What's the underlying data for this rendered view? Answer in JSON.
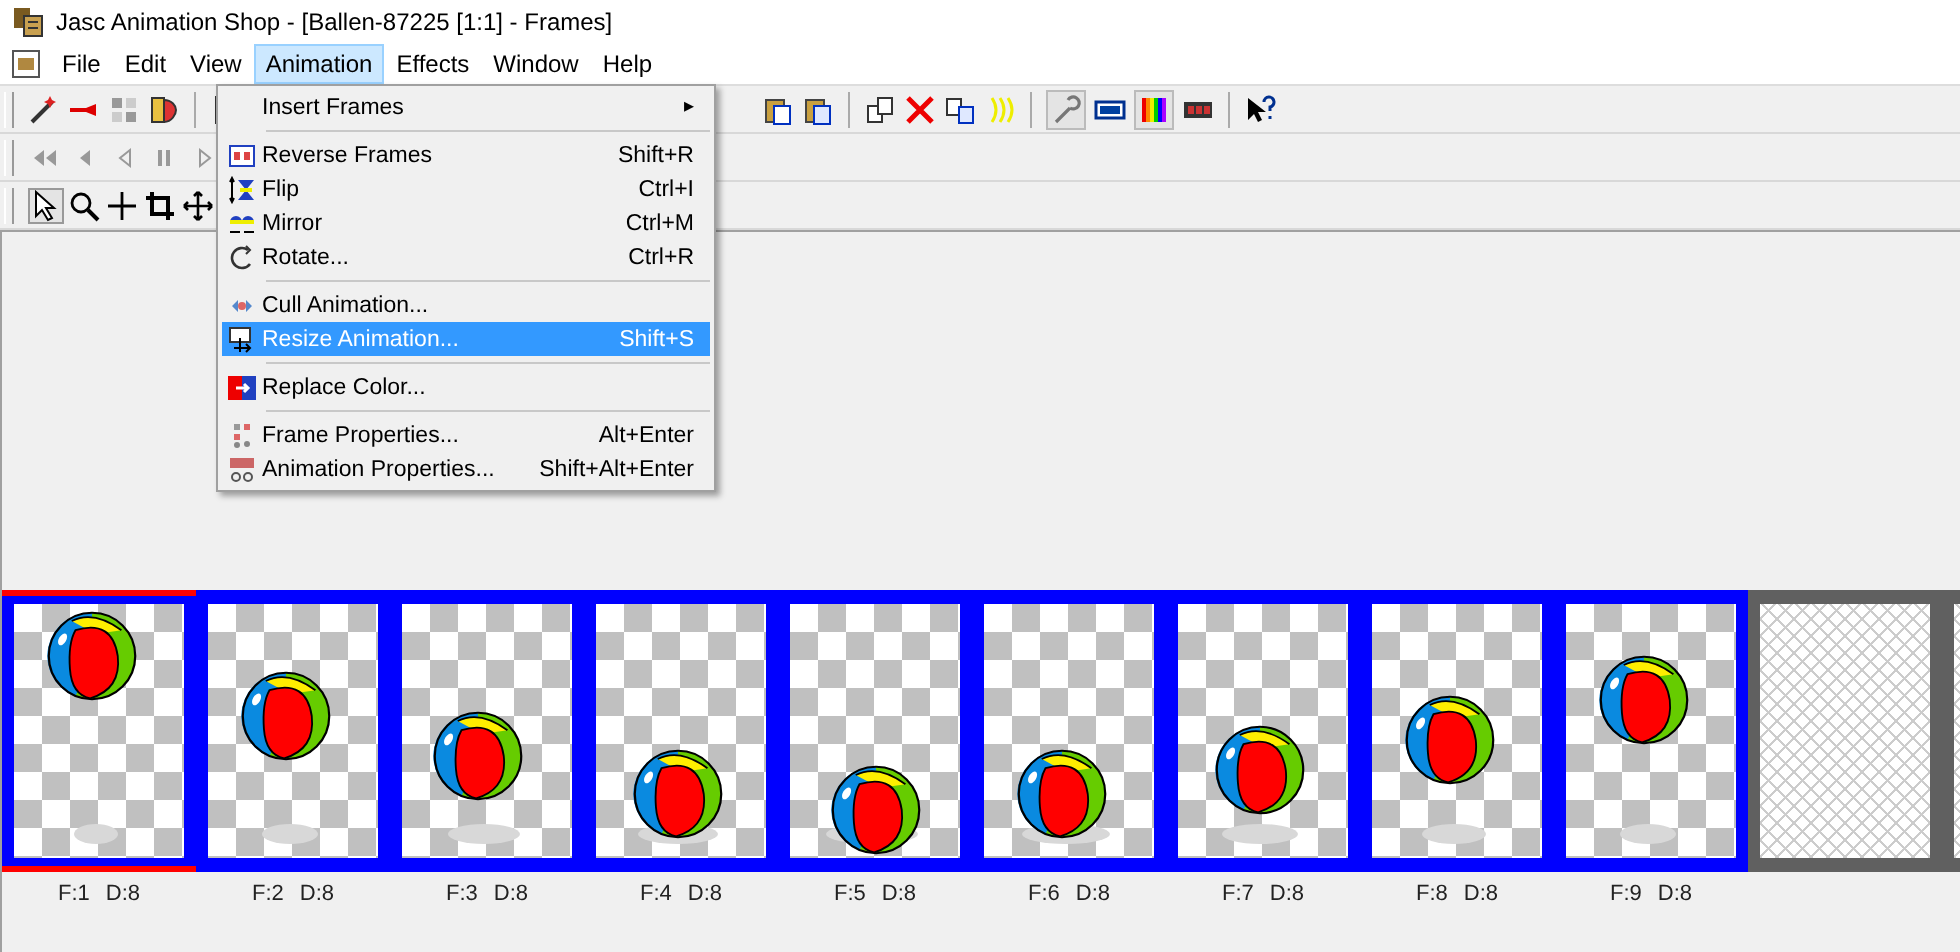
{
  "window": {
    "title": "Jasc Animation Shop - [Ballen-87225 [1:1] - Frames]"
  },
  "menu_bar": [
    {
      "label": "File",
      "selected": false
    },
    {
      "label": "Edit",
      "selected": false
    },
    {
      "label": "View",
      "selected": false
    },
    {
      "label": "Animation",
      "selected": true
    },
    {
      "label": "Effects",
      "selected": false
    },
    {
      "label": "Window",
      "selected": false
    },
    {
      "label": "Help",
      "selected": false
    }
  ],
  "tools": [
    {
      "selected": true
    },
    {
      "selected": false
    },
    {
      "selected": false
    },
    {
      "selected": false
    },
    {
      "selected": false
    }
  ],
  "animation_menu": [
    [
      {
        "label": "Insert Frames",
        "submenu_arrow": "▸",
        "selected": false
      }
    ],
    [
      {
        "label": "Reverse Frames",
        "shortcut": "Shift+R",
        "selected": false
      },
      {
        "label": "Flip",
        "shortcut": "Ctrl+I",
        "selected": false
      },
      {
        "label": "Mirror",
        "shortcut": "Ctrl+M",
        "selected": false
      },
      {
        "label": "Rotate...",
        "shortcut": "Ctrl+R",
        "selected": false
      }
    ],
    [
      {
        "label": "Cull Animation...",
        "selected": false
      },
      {
        "label": "Resize Animation...",
        "shortcut": "Shift+S",
        "selected": true
      }
    ],
    [
      {
        "label": "Replace Color...",
        "selected": false
      }
    ],
    [
      {
        "label": "Frame Properties...",
        "shortcut": "Alt+Enter",
        "selected": false
      },
      {
        "label": "Animation Properties...",
        "shortcut": "Shift+Alt+Enter",
        "selected": false
      }
    ]
  ],
  "frames": [
    {
      "kind": "frame",
      "frame": "F:1",
      "delay": "D:8",
      "selected": true
    },
    {
      "kind": "frame",
      "frame": "F:2",
      "delay": "D:8",
      "selected": false
    },
    {
      "kind": "frame",
      "frame": "F:3",
      "delay": "D:8",
      "selected": false
    },
    {
      "kind": "frame",
      "frame": "F:4",
      "delay": "D:8",
      "selected": false
    },
    {
      "kind": "frame",
      "frame": "F:5",
      "delay": "D:8",
      "selected": false
    },
    {
      "kind": "frame",
      "frame": "F:6",
      "delay": "D:8",
      "selected": false
    },
    {
      "kind": "frame",
      "frame": "F:7",
      "delay": "D:8",
      "selected": false
    },
    {
      "kind": "frame",
      "frame": "F:8",
      "delay": "D:8",
      "selected": false
    },
    {
      "kind": "frame",
      "frame": "F:9",
      "delay": "D:8",
      "selected": false
    },
    {
      "kind": "empty"
    },
    {
      "kind": "empty"
    }
  ]
}
